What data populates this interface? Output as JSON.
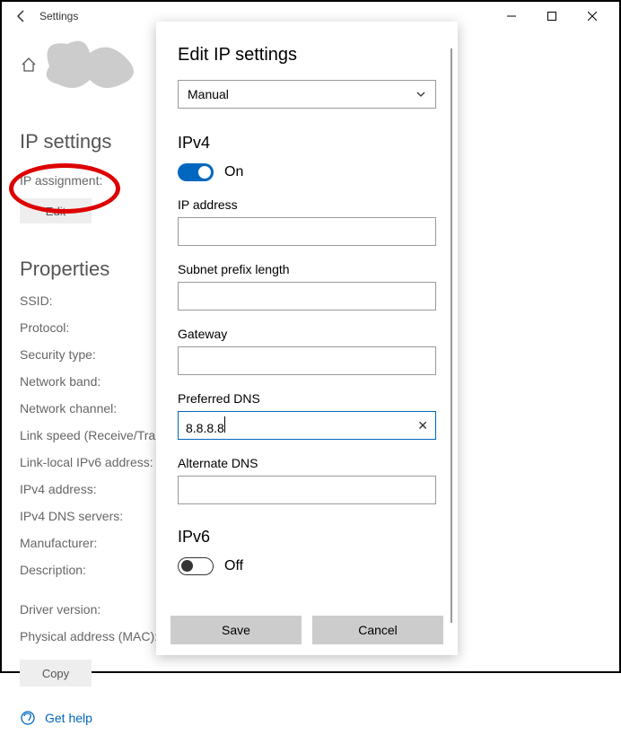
{
  "window": {
    "title": "Settings"
  },
  "bg": {
    "heading1": "IP settings",
    "ip_assignment_label": "IP assignment:",
    "edit_label": "Edit",
    "heading2": "Properties",
    "props": [
      "SSID:",
      "Protocol:",
      "Security type:",
      "Network band:",
      "Network channel:",
      "Link speed (Receive/Tran",
      "Link-local IPv6 address:",
      "IPv4 address:",
      "IPv4 DNS servers:",
      "Manufacturer:",
      "Description:"
    ],
    "driver_label": "Driver version:",
    "mac_label": "Physical address (MAC):",
    "copy_label": "Copy",
    "help_label": "Get help"
  },
  "dialog": {
    "title": "Edit IP settings",
    "mode": "Manual",
    "ipv4": {
      "heading": "IPv4",
      "toggle_label": "On",
      "ip_label": "IP address",
      "ip_value": "",
      "subnet_label": "Subnet prefix length",
      "subnet_value": "",
      "gateway_label": "Gateway",
      "gateway_value": "",
      "pdns_label": "Preferred DNS",
      "pdns_value": "8.8.8.8",
      "adns_label": "Alternate DNS",
      "adns_value": ""
    },
    "ipv6": {
      "heading": "IPv6",
      "toggle_label": "Off"
    },
    "save_label": "Save",
    "cancel_label": "Cancel"
  }
}
